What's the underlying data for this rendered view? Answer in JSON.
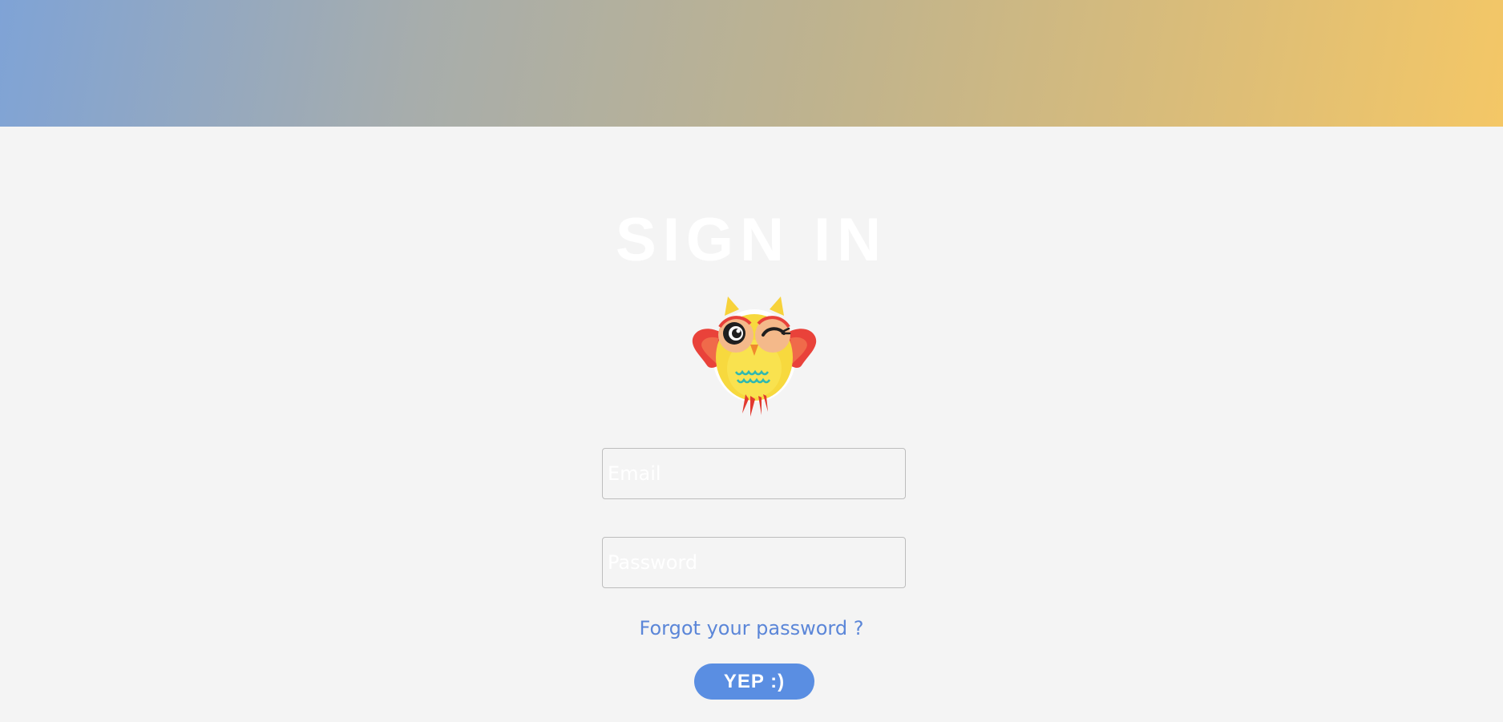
{
  "header": {
    "gradient_start": "#7fa3d6",
    "gradient_end": "#f4c766"
  },
  "page": {
    "title": "SIGN IN",
    "mascot_icon": "winking-owl-icon"
  },
  "form": {
    "email_placeholder": "Email",
    "password_placeholder": "Password",
    "forgot_link": "Forgot your password ?",
    "submit_label": "YEP :)"
  },
  "colors": {
    "background": "#f4f4f4",
    "link": "#5b86d8",
    "button": "#5a8ee2",
    "title": "#ffffff"
  }
}
